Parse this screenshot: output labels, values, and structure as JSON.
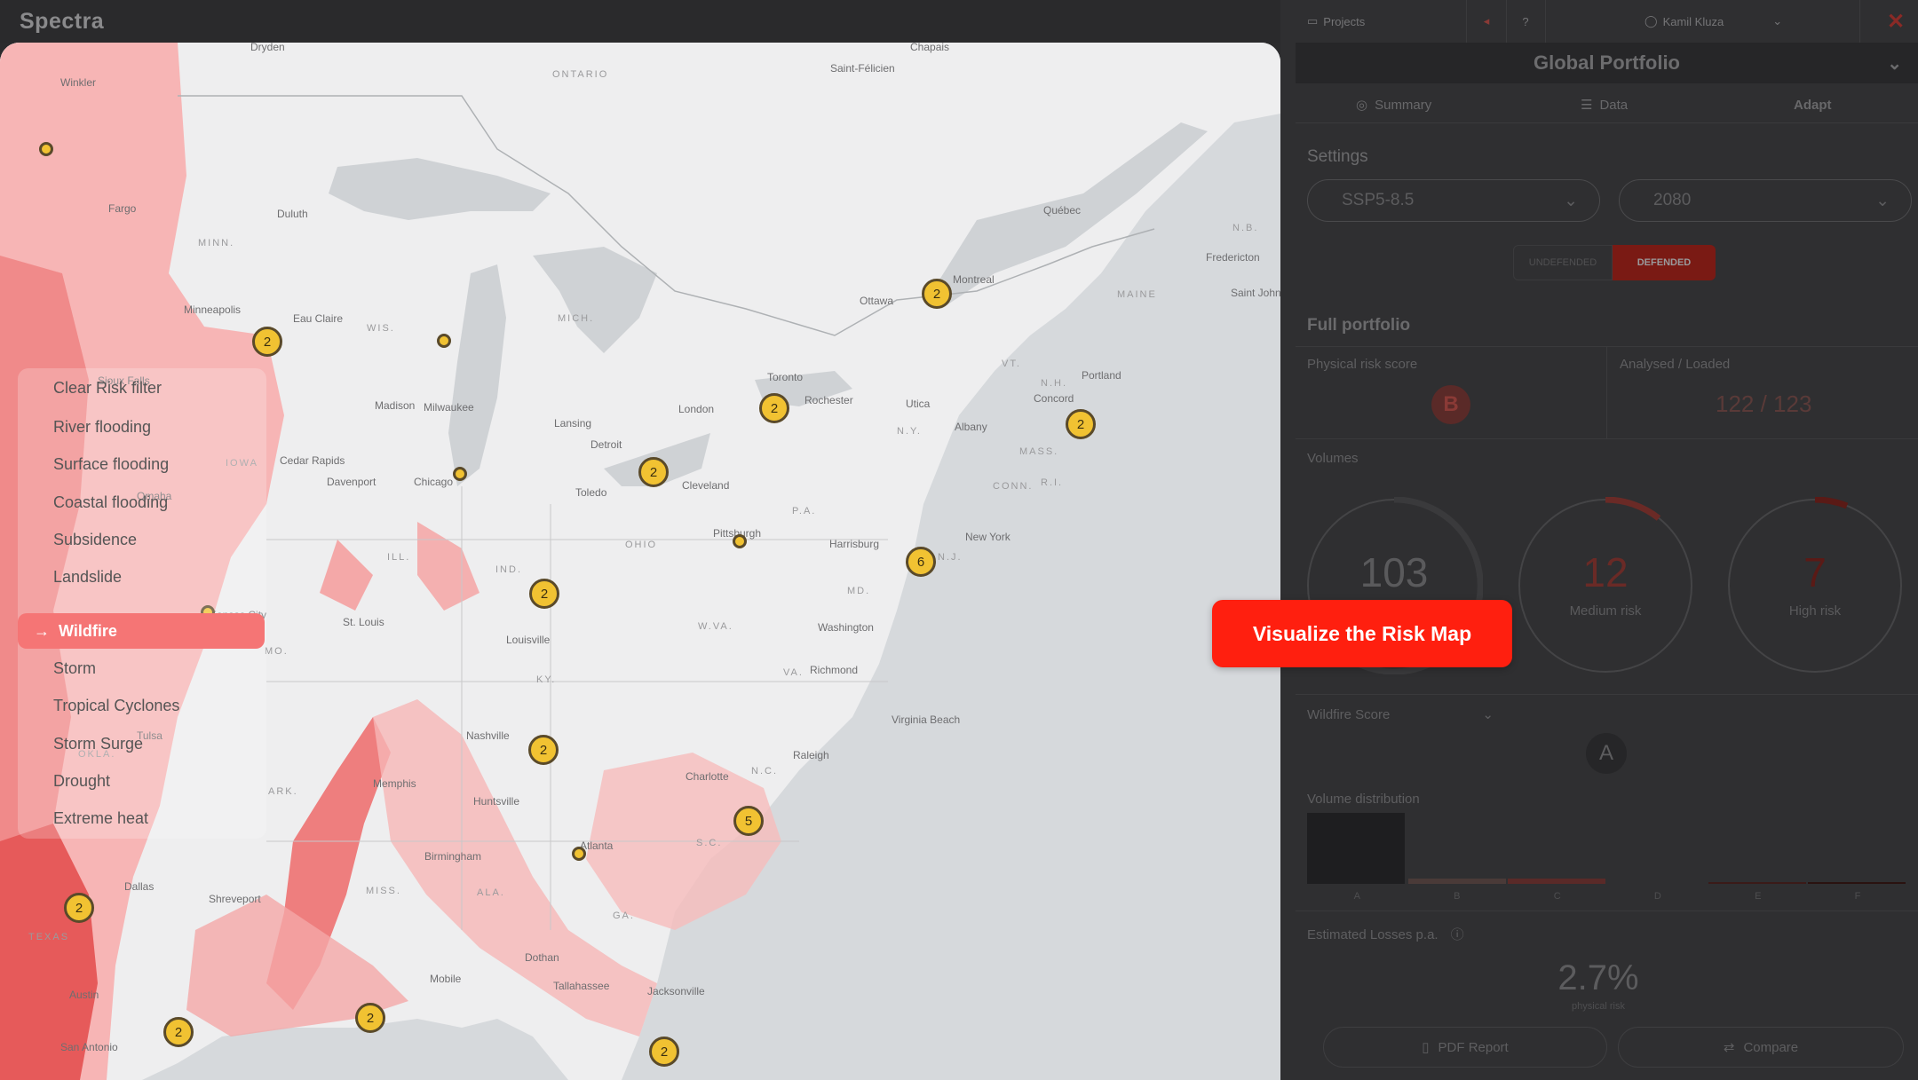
{
  "app": {
    "logo": "Spectra"
  },
  "header": {
    "projects_label": "Projects",
    "user_name": "Kamil Kluza"
  },
  "panel": {
    "title": "Global Portfolio",
    "tabs": [
      {
        "label": "Summary"
      },
      {
        "label": "Data"
      },
      {
        "label": "Adapt"
      }
    ],
    "settings_title": "Settings",
    "scenario": "SSP5-8.5",
    "year": "2080",
    "toggle": {
      "undefended": "UNDEFENDED",
      "defended": "DEFENDED",
      "active": "defended"
    },
    "full_portfolio": "Full portfolio",
    "physical_risk_label": "Physical risk score",
    "physical_risk_grade": "B",
    "analysed_loaded_label": "Analysed / Loaded",
    "analysed_loaded_value": "122 / 123",
    "volumes_label": "Volumes",
    "volumes": [
      {
        "value": "103",
        "label": "",
        "fraction": 0.55
      },
      {
        "value": "12",
        "label": "Medium risk",
        "fraction": 0.1
      },
      {
        "value": "7",
        "label": "High risk",
        "fraction": 0.06
      }
    ],
    "wildfire_score_label": "Wildfire Score",
    "wildfire_grade": "A",
    "volume_distribution_label": "Volume distribution",
    "distribution_categories": [
      "A",
      "B",
      "C",
      "D",
      "E",
      "F"
    ],
    "estimated_losses_label": "Estimated Losses p.a.",
    "estimated_losses_value": "2.7%",
    "estimated_losses_sub": "physical risk",
    "pdf_report_label": "PDF Report",
    "compare_label": "Compare"
  },
  "cta": {
    "label": "Visualize the Risk Map"
  },
  "risk_menu": {
    "items": [
      "Clear Risk filter",
      "River flooding",
      "Surface flooding",
      "Coastal flooding",
      "Subsidence",
      "Landslide",
      "Wildfire",
      "Storm",
      "Tropical Cyclones",
      "Storm Surge",
      "Drought",
      "Extreme heat"
    ],
    "active": "Wildfire"
  },
  "map": {
    "places": [
      "Winkler",
      "Dryden",
      "ONTARIO",
      "Chapais",
      "Saint-Félicien",
      "Québec",
      "Fargo",
      "Duluth",
      "MINN.",
      "Minneapolis",
      "Eau Claire",
      "WIS.",
      "MICH.",
      "Ottawa",
      "Montreal",
      "N.B.",
      "Fredericton",
      "MAINE",
      "Saint John",
      "Sioux Falls",
      "Madison",
      "Milwaukee",
      "London",
      "Toronto",
      "Rochester",
      "Utica",
      "VT.",
      "N.H.",
      "Portland",
      "Concord",
      "IOWA",
      "Cedar Rapids",
      "Davenport",
      "Chicago",
      "Lansing",
      "Detroit",
      "N.Y.",
      "Albany",
      "MASS.",
      "Omaha",
      "Toledo",
      "Cleveland",
      "CONN.",
      "R.I.",
      "ILL.",
      "OHIO",
      "P.A.",
      "Pittsburgh",
      "Harrisburg",
      "New York",
      "N.J.",
      "IND.",
      "MD.",
      "Washington",
      "Kansas City",
      "St. Louis",
      "Louisville",
      "W.VA.",
      "VA.",
      "Richmond",
      "MO.",
      "KY.",
      "Virginia Beach",
      "Nashville",
      "Raleigh",
      "Charlotte",
      "N.C.",
      "Tulsa",
      "OKLA.",
      "ARK.",
      "Memphis",
      "Huntsville",
      "Atlanta",
      "S.C.",
      "Birmingham",
      "MISS.",
      "ALA.",
      "GA.",
      "Dallas",
      "Shreveport",
      "TEXAS",
      "Dothan",
      "Mobile",
      "Tallahassee",
      "Jacksonville",
      "Austin",
      "San Antonio"
    ],
    "clusters": [
      2,
      2,
      2,
      2,
      2,
      6,
      2,
      2,
      5,
      2,
      2,
      2,
      2
    ]
  }
}
